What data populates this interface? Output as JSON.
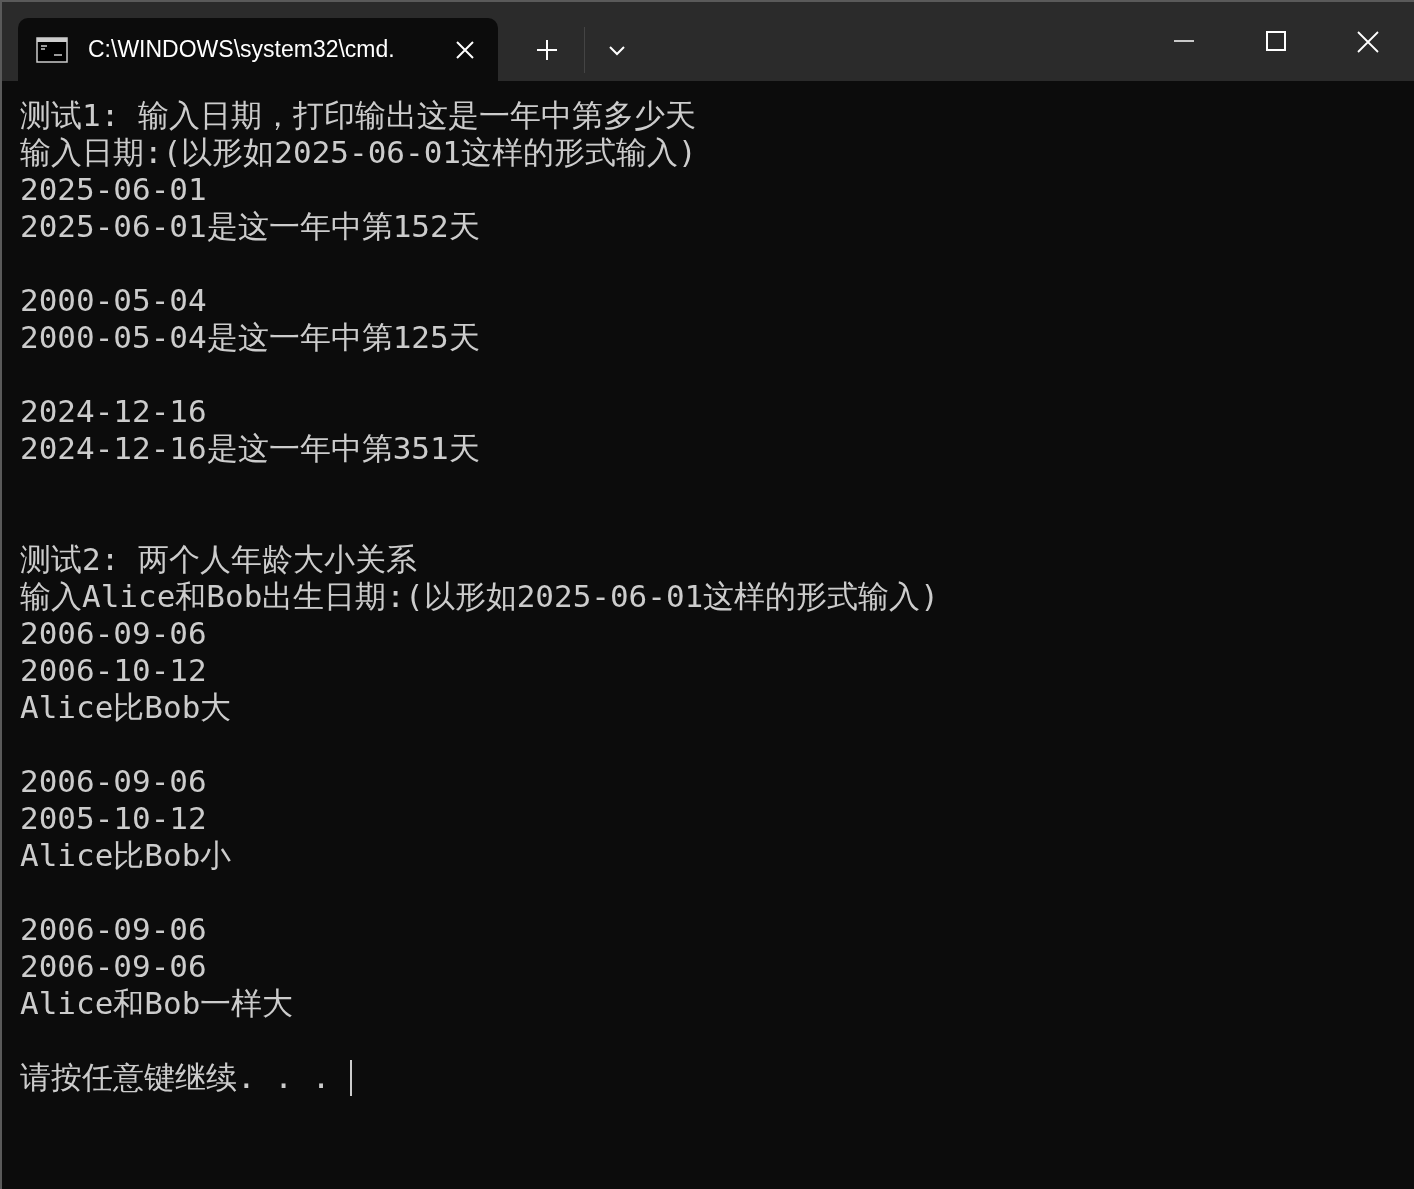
{
  "window": {
    "tab": {
      "title": "C:\\WINDOWS\\system32\\cmd.",
      "selected": true
    }
  },
  "terminal": {
    "sections": [
      {
        "blocks": [
          {
            "lines": [
              "测试1: 输入日期，打印输出这是一年中第多少天",
              "输入日期:(以形如2025-06-01这样的形式输入)",
              "2025-06-01",
              "2025-06-01是这一年中第152天"
            ]
          },
          {
            "lines": [
              "2000-05-04",
              "2000-05-04是这一年中第125天"
            ]
          },
          {
            "lines": [
              "2024-12-16",
              "2024-12-16是这一年中第351天"
            ]
          }
        ]
      },
      {
        "blocks": [
          {
            "lines": [
              "测试2: 两个人年龄大小关系",
              "输入Alice和Bob出生日期:(以形如2025-06-01这样的形式输入)",
              "2006-09-06",
              "2006-10-12",
              "Alice比Bob大"
            ]
          },
          {
            "lines": [
              "2006-09-06",
              "2005-10-12",
              "Alice比Bob小"
            ]
          },
          {
            "lines": [
              "2006-09-06",
              "2006-09-06",
              "Alice和Bob一样大"
            ]
          },
          {
            "lines": [
              "请按任意键继续. . ."
            ]
          }
        ]
      }
    ],
    "cursor": true
  }
}
